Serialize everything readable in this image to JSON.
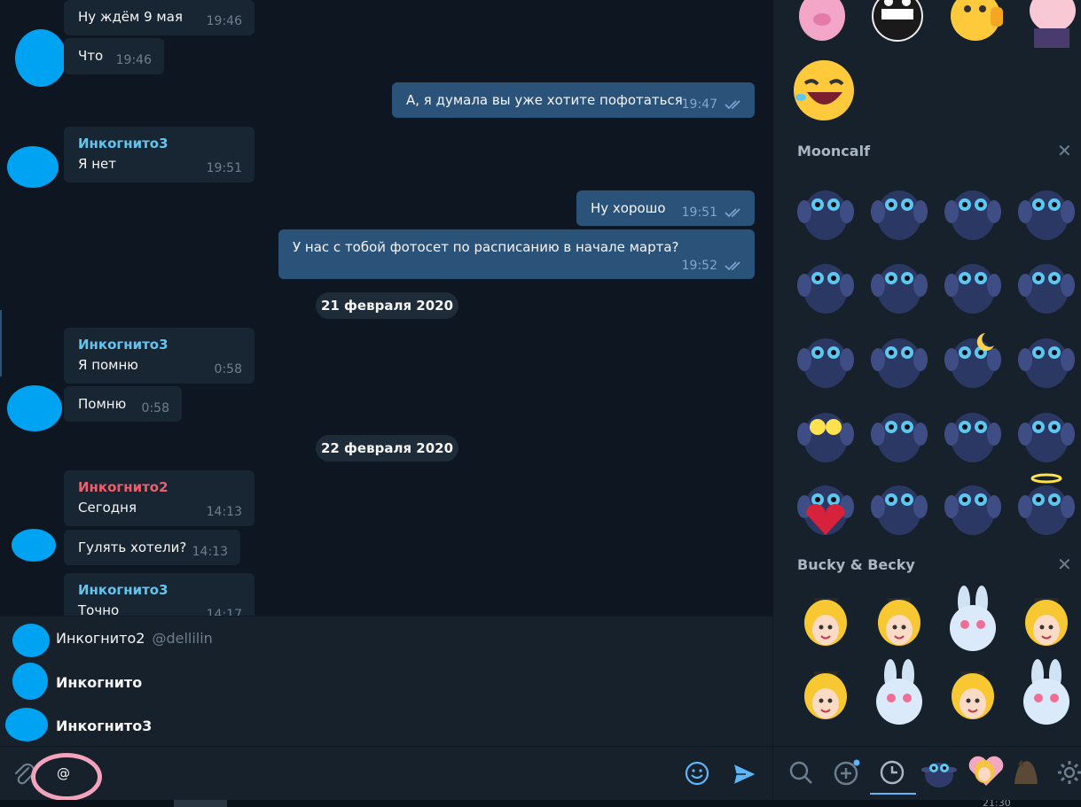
{
  "chat": {
    "dates": [
      "21 февраля 2020",
      "22 февраля 2020"
    ],
    "messages": [
      {
        "text": "Ну ждём 9 мая",
        "time": "19:46"
      },
      {
        "text": "Что",
        "time": "19:46"
      },
      {
        "text": "А, я думала вы уже хотите пофотаться",
        "time": "19:47"
      },
      {
        "sender": "Инкогнито3",
        "text": "Я нет",
        "time": "19:51"
      },
      {
        "text": "Ну хорошо",
        "time": "19:51"
      },
      {
        "text": "У нас с тобой фотосет по расписанию в начале марта?",
        "time": "19:52"
      },
      {
        "sender": "Инкогнито3",
        "text": "Я помню",
        "time": "0:58"
      },
      {
        "text": "Помню",
        "time": "0:58"
      },
      {
        "sender": "Инкогнито2",
        "text": "Сегодня",
        "time": "14:13"
      },
      {
        "text": "Гулять хотели?",
        "time": "14:13"
      },
      {
        "sender": "Инкогнито3",
        "text": "Точно",
        "time": "14:17"
      }
    ]
  },
  "mentions": [
    {
      "name": "Инкогнито2",
      "handle": "@dellilin"
    },
    {
      "name": "Инкогнито"
    },
    {
      "name": "Инкогнито3"
    }
  ],
  "input": {
    "value": "@"
  },
  "sticker_panel": {
    "sets": [
      {
        "title": "Mooncalf",
        "close": "✕"
      },
      {
        "title": "Bucky & Becky",
        "close": "✕"
      }
    ]
  },
  "taskbar": {
    "clock": "21:30"
  },
  "colors": {
    "sender_blue": "#64c4ee",
    "sender_red": "#ee5f6b",
    "accent": "#5eb5f7",
    "avatar": "#00a2f2"
  }
}
